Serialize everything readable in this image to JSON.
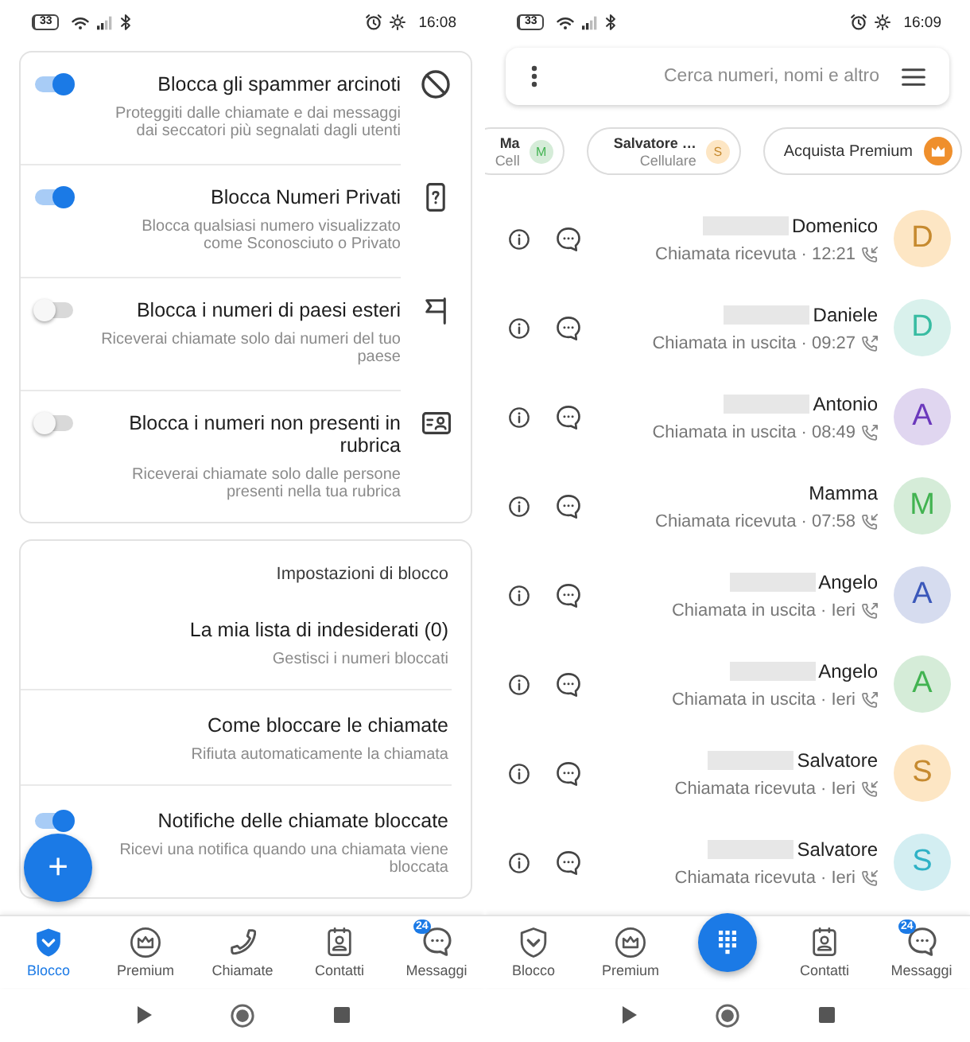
{
  "screens": [
    {
      "status_bar": {
        "battery": "33",
        "time": "16:08"
      },
      "cards": [
        {
          "rows": [
            {
              "kind": "block",
              "title": "Blocca gli spammer arcinoti",
              "description": "Proteggiti dalle chiamate e dai messaggi dai seccatori più segnalati dagli utenti",
              "on": true
            },
            {
              "kind": "phone",
              "title": "Blocca Numeri Privati",
              "description": "Blocca qualsiasi numero visualizzato come Sconosciuto o Privato",
              "on": true
            },
            {
              "kind": "flag",
              "title": "Blocca i numeri di paesi esteri",
              "description": "Riceverai chiamate solo dai numeri del tuo paese",
              "on": false
            },
            {
              "kind": "card",
              "title": "Blocca i numeri non presenti in rubrica",
              "description": "Riceverai chiamate solo dalle persone presenti nella tua rubrica",
              "on": false
            }
          ]
        },
        {
          "header": "Impostazioni di blocco",
          "rows": [
            {
              "kind": "link",
              "title": "La mia lista di indesiderati (0)",
              "description": "Gestisci i numeri bloccati"
            },
            {
              "kind": "link",
              "title": "Come bloccare le chiamate",
              "description": "Rifiuta automaticamente la chiamata"
            },
            {
              "kind": "toggle",
              "title": "Notifiche delle chiamate bloccate",
              "description": "Ricevi una notifica quando una chiamata viene bloccata",
              "on": true
            }
          ]
        }
      ],
      "fab": {
        "label": "+"
      },
      "nav": [
        {
          "kind": "shield",
          "label": "Blocco",
          "selected": true
        },
        {
          "kind": "crown",
          "label": "Premium",
          "selected": false
        },
        {
          "kind": "phone",
          "label": "Chiamate",
          "selected": false
        },
        {
          "kind": "contact",
          "label": "Contatti",
          "selected": false
        },
        {
          "kind": "chat",
          "label": "Messaggi",
          "selected": false,
          "badge": "24"
        }
      ]
    },
    {
      "status_bar": {
        "battery": "33",
        "time": "16:09"
      },
      "search": {
        "placeholder": "Cerca numeri, nomi e altro"
      },
      "chips": [
        {
          "kind": "contact",
          "initial": "M",
          "title": "Ma",
          "subtitle": "Cell",
          "color": "#d5ecd8"
        },
        {
          "kind": "contact",
          "initial": "S",
          "title": "Salvatore …",
          "subtitle": "Cellulare",
          "color": "#fde6c4"
        },
        {
          "kind": "premium",
          "title": "Acquista Premium"
        }
      ],
      "calls": [
        {
          "kind": "incoming",
          "initial": "D",
          "name": "Domenico",
          "redacted": true,
          "detail": "Chiamata ricevuta · 12:21",
          "color": "#fde6c4"
        },
        {
          "kind": "outgoing",
          "initial": "D",
          "name": "Daniele",
          "redacted": true,
          "detail": "Chiamata in uscita · 09:27",
          "color": "#d9f1ec"
        },
        {
          "kind": "outgoing",
          "initial": "A",
          "name": "Antonio",
          "redacted": true,
          "detail": "Chiamata in uscita · 08:49",
          "color": "#e0d6f0"
        },
        {
          "kind": "incoming",
          "initial": "M",
          "name": "Mamma",
          "redacted": false,
          "detail": "Chiamata ricevuta · 07:58",
          "color": "#d5ecd8"
        },
        {
          "kind": "outgoing",
          "initial": "A",
          "name": "Angelo",
          "redacted": true,
          "detail": "Chiamata in uscita · Ieri",
          "color": "#d6dcef"
        },
        {
          "kind": "outgoing",
          "initial": "A",
          "name": "Angelo",
          "redacted": true,
          "detail": "Chiamata in uscita · Ieri",
          "color": "#d5ecd8"
        },
        {
          "kind": "incoming",
          "initial": "S",
          "name": "Salvatore",
          "redacted": true,
          "detail": "Chiamata ricevuta · Ieri",
          "color": "#fde6c4"
        },
        {
          "kind": "incoming",
          "initial": "S",
          "name": "Salvatore",
          "redacted": true,
          "detail": "Chiamata ricevuta · Ieri",
          "color": "#d3eef2"
        }
      ],
      "nav": [
        {
          "kind": "shield",
          "label": "Blocco",
          "selected": false
        },
        {
          "kind": "crown",
          "label": "Premium",
          "selected": false
        },
        {
          "kind": "dialpad",
          "selected": true
        },
        {
          "kind": "contact",
          "label": "Contatti",
          "selected": false
        },
        {
          "kind": "chat",
          "label": "Messaggi",
          "selected": false,
          "badge": "24"
        }
      ]
    }
  ]
}
